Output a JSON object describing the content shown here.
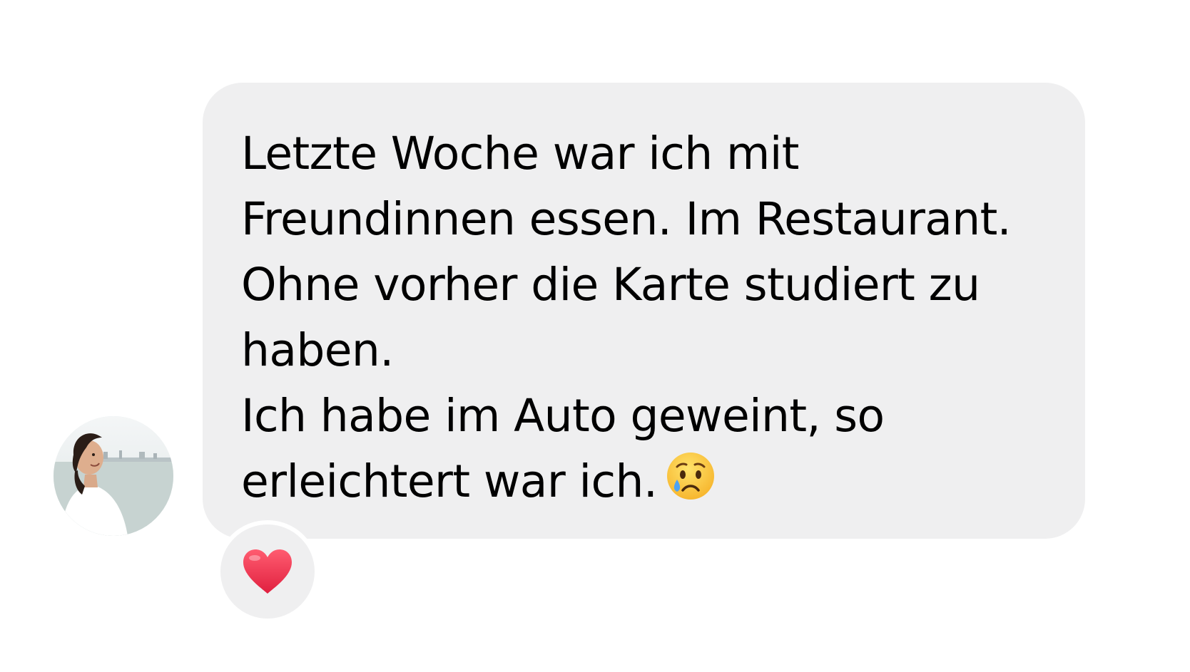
{
  "message": {
    "lines": [
      "Letzte Woche war ich mit",
      "Freundinnen essen. Im Restaurant.",
      "Ohne vorher die Karte studiert zu",
      "haben.",
      "Ich habe im Auto geweint, so",
      "erleichtert war ich."
    ],
    "trailing_emoji": "crying-face-icon"
  },
  "sender": {
    "avatar": "avatar-photo"
  },
  "reaction": {
    "icon": "red-heart-icon",
    "color": "#f0394f"
  },
  "colors": {
    "bubble": "#efeff0",
    "text": "#000000",
    "background": "#ffffff"
  }
}
